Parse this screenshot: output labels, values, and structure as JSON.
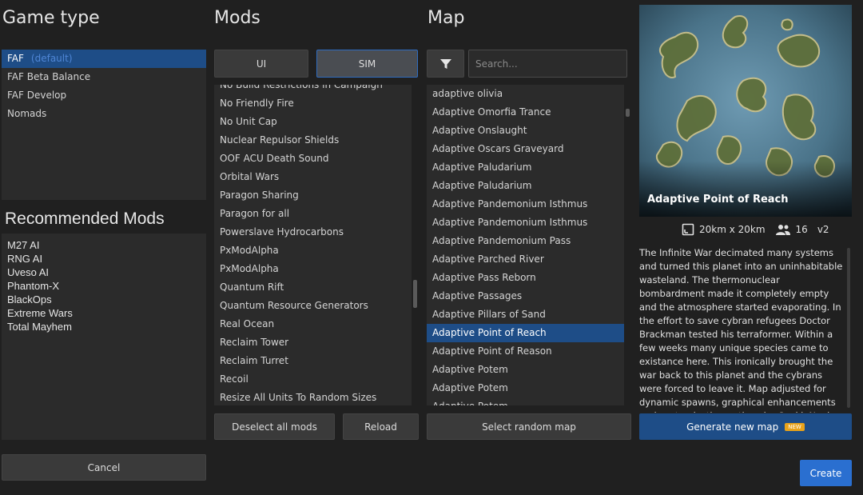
{
  "game_type": {
    "heading": "Game type",
    "items": [
      {
        "label": "FAF",
        "default_tag": "(default)",
        "selected": true
      },
      {
        "label": "FAF Beta Balance"
      },
      {
        "label": "FAF Develop"
      },
      {
        "label": "Nomads"
      }
    ]
  },
  "recommended_mods": {
    "heading": "Recommended Mods",
    "items": [
      "M27 AI",
      "RNG AI",
      "Uveso AI",
      "Phantom-X",
      "BlackOps",
      "Extreme Wars",
      "Total Mayhem"
    ]
  },
  "cancel_label": "Cancel",
  "mods": {
    "heading": "Mods",
    "ui_label": "UI",
    "sim_label": "SIM",
    "items": [
      "No Build Restrictions in Campaign",
      "No Friendly Fire",
      "No Unit Cap",
      "Nuclear Repulsor Shields",
      "OOF ACU Death Sound",
      "Orbital Wars",
      "Paragon Sharing",
      "Paragon for all",
      "Powerslave Hydrocarbons",
      "PxModAlpha",
      "PxModAlpha",
      "Quantum Rift",
      "Quantum Resource Generators",
      "Real Ocean",
      "Reclaim Tower",
      "Reclaim Turret",
      "Recoil",
      "Resize All Units To Random Sizes"
    ],
    "deselect_label": "Deselect all mods",
    "reload_label": "Reload"
  },
  "map": {
    "heading": "Map",
    "search_placeholder": "Search...",
    "items": [
      {
        "label": "adaptive olivia"
      },
      {
        "label": "Adaptive Omorfia Trance"
      },
      {
        "label": "Adaptive Onslaught"
      },
      {
        "label": "Adaptive Oscars Graveyard"
      },
      {
        "label": "Adaptive Paludarium"
      },
      {
        "label": "Adaptive Paludarium"
      },
      {
        "label": "Adaptive Pandemonium Isthmus"
      },
      {
        "label": "Adaptive Pandemonium Isthmus"
      },
      {
        "label": "Adaptive Pandemonium Pass"
      },
      {
        "label": "Adaptive Parched River"
      },
      {
        "label": "Adaptive Pass Reborn"
      },
      {
        "label": "Adaptive Passages"
      },
      {
        "label": "Adaptive Pillars of Sand"
      },
      {
        "label": "Adaptive Point of Reach",
        "selected": true
      },
      {
        "label": "Adaptive Point of Reason"
      },
      {
        "label": "Adaptive Potem"
      },
      {
        "label": "Adaptive Potem"
      },
      {
        "label": "Adaptive Potem"
      }
    ],
    "random_label": "Select random map"
  },
  "preview": {
    "title": "Adaptive Point of Reach",
    "size": "20km x 20km",
    "players": "16",
    "version": "v2",
    "description": "The Infinite War decimated many systems and turned this planet into an uninhabitable wasteland. The thermonuclear bombardment made it completely empty and the atmosphere started evaporating. In the effort to save cybran refugees Doctor Brackman tested his terraformer. Within a few weeks many unique species came to existance here. This ironically brought the war back to this planet and the cybrans were forced to leave it. Map adjusted for dynamic spawns, graphical enhancements and customization options by CookieNoob. Update to highly configurable map by..."
  },
  "generate_label": "Generate new map",
  "new_badge": "NEW",
  "create_label": "Create",
  "colors": {
    "accent": "#2a6fd0",
    "selection": "#1e4d87",
    "badge": "#e8a21a"
  }
}
